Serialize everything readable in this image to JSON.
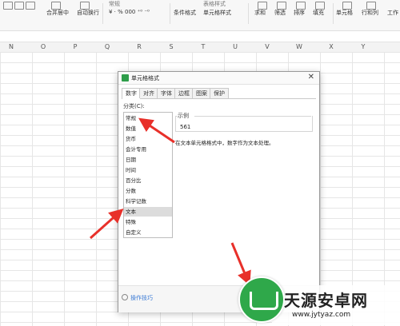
{
  "ribbon": {
    "top_labels": {
      "normal": "常规",
      "table_style": "表格样式"
    },
    "labels": {
      "merge": "合并居中",
      "wrap": "自动换行",
      "number_format": "¥ · % 000 ⁺⁰ ⁻⁰",
      "conditional": "条件格式",
      "cell_style": "单元格样式",
      "sum": "求和",
      "filter": "筛选",
      "sort": "排序",
      "fill": "填充",
      "cell": "单元格",
      "rowcol": "行和列",
      "worksheet": "工作"
    }
  },
  "columns": [
    "N",
    "O",
    "P",
    "Q",
    "R",
    "S",
    "T",
    "U",
    "V",
    "W",
    "X",
    "Y"
  ],
  "dialog": {
    "title": "单元格格式",
    "close": "✕",
    "tabs": [
      "数字",
      "对齐",
      "字体",
      "边框",
      "图案",
      "保护"
    ],
    "category_label": "分类(C):",
    "categories": [
      "常规",
      "数值",
      "货币",
      "会计专用",
      "日期",
      "时间",
      "百分比",
      "分数",
      "科学记数",
      "文本",
      "特殊",
      "自定义"
    ],
    "selected_category": "文本",
    "sample_label": "示例",
    "sample_value": "561",
    "description": "在文本单元格格式中，数字作为文本处理。",
    "footer_tip": "操作技巧"
  },
  "watermark": {
    "name": "天源安卓网",
    "url": "www.jytyaz.com"
  },
  "colors": {
    "arrow": "#e8302a",
    "accent": "#2fa84a",
    "tip": "#3a7ad5"
  }
}
